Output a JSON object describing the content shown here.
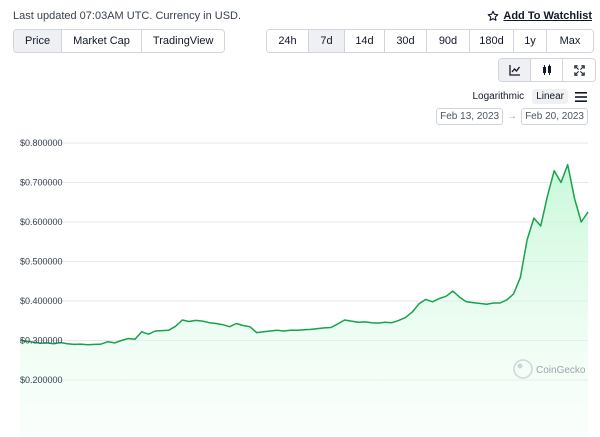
{
  "header": {
    "last_updated": "Last updated 07:03AM UTC. Currency in USD.",
    "watchlist_label": "Add To Watchlist"
  },
  "view_tabs": [
    {
      "label": "Price",
      "active": true
    },
    {
      "label": "Market Cap",
      "active": false
    },
    {
      "label": "TradingView",
      "active": false
    }
  ],
  "range_tabs": [
    {
      "label": "24h",
      "active": false
    },
    {
      "label": "7d",
      "active": true
    },
    {
      "label": "14d",
      "active": false
    },
    {
      "label": "30d",
      "active": false
    },
    {
      "label": "90d",
      "active": false
    },
    {
      "label": "180d",
      "active": false
    },
    {
      "label": "1y",
      "active": false
    },
    {
      "label": "Max",
      "active": false
    }
  ],
  "chart_style_buttons": [
    {
      "icon": "line-chart-icon",
      "active": true
    },
    {
      "icon": "candlestick-icon",
      "active": false
    },
    {
      "icon": "fullscreen-icon",
      "active": false
    }
  ],
  "scale": {
    "logarithmic_label": "Logarithmic",
    "linear_label": "Linear",
    "active": "linear"
  },
  "date_range": {
    "from": "Feb 13, 2023",
    "to": "Feb 20, 2023",
    "arrow": "→"
  },
  "watermark": "CoinGecko",
  "colors": {
    "line": "#16a34a",
    "fill": "#dcfce7",
    "grid": "#e5e7eb"
  },
  "chart_data": {
    "type": "area",
    "y_tick_labels": [
      "$0.800000",
      "$0.700000",
      "$0.600000",
      "$0.500000",
      "$0.400000",
      "$0.300000",
      "$0.200000"
    ],
    "y_ticks": [
      0.8,
      0.7,
      0.6,
      0.5,
      0.4,
      0.3,
      0.2
    ],
    "ylim": [
      0.2,
      0.8
    ],
    "x": [
      0,
      2,
      4,
      6,
      8,
      10,
      12,
      14,
      16,
      18,
      20,
      22,
      24,
      26,
      28,
      30,
      32,
      34,
      36,
      38,
      40,
      42,
      44,
      46,
      48,
      50,
      52,
      54,
      56,
      58,
      60,
      62,
      64,
      66,
      68,
      70,
      72,
      74,
      76,
      78,
      80,
      82,
      84,
      86,
      88,
      90,
      92,
      94,
      96,
      98,
      100,
      102,
      104,
      106,
      108,
      110,
      112,
      114,
      116,
      118,
      120,
      122,
      124,
      126,
      128,
      130,
      132,
      134,
      136,
      138,
      140,
      142,
      144,
      146,
      148,
      150,
      152,
      154,
      156,
      158,
      160,
      162,
      164,
      166,
      168
    ],
    "values": [
      0.3,
      0.298,
      0.296,
      0.293,
      0.294,
      0.292,
      0.295,
      0.292,
      0.29,
      0.291,
      0.289,
      0.29,
      0.291,
      0.297,
      0.294,
      0.3,
      0.305,
      0.303,
      0.322,
      0.316,
      0.324,
      0.325,
      0.326,
      0.336,
      0.352,
      0.348,
      0.351,
      0.349,
      0.345,
      0.343,
      0.34,
      0.335,
      0.343,
      0.338,
      0.335,
      0.32,
      0.322,
      0.324,
      0.326,
      0.324,
      0.326,
      0.326,
      0.327,
      0.328,
      0.33,
      0.332,
      0.333,
      0.342,
      0.352,
      0.349,
      0.346,
      0.347,
      0.345,
      0.344,
      0.346,
      0.345,
      0.351,
      0.358,
      0.372,
      0.393,
      0.404,
      0.398,
      0.406,
      0.412,
      0.425,
      0.41,
      0.398,
      0.396,
      0.394,
      0.392,
      0.395,
      0.395,
      0.403,
      0.418,
      0.46,
      0.555,
      0.61,
      0.59,
      0.665,
      0.73,
      0.7,
      0.745,
      0.66,
      0.6,
      0.625
    ]
  }
}
